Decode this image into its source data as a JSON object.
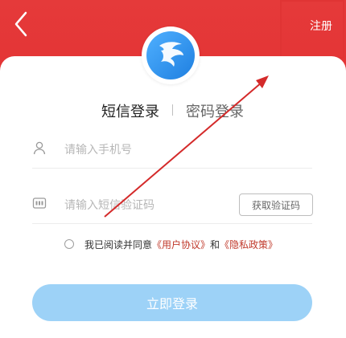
{
  "header": {
    "register_label": "注册",
    "bg_color": "#e43435"
  },
  "icons": {
    "back": "chevron-left-icon",
    "user": "user-icon",
    "code": "message-code-icon",
    "logo": "app-logo"
  },
  "tabs": [
    {
      "label": "短信登录",
      "active": true
    },
    {
      "label": "密码登录",
      "active": false
    }
  ],
  "form": {
    "phone_placeholder": "请输入手机号",
    "code_placeholder": "请输入短信验证码",
    "get_code_label": "获取验证码"
  },
  "agreement": {
    "prefix": "我已阅读并同意",
    "user_agreement": "《用户协议》",
    "and": "和",
    "privacy_policy": "《隐私政策》",
    "checked": false
  },
  "login_button": {
    "label": "立即登录",
    "color": "#9dd2f7"
  },
  "accent_colors": {
    "brand_red": "#e43435",
    "link_red": "#c0392b"
  }
}
